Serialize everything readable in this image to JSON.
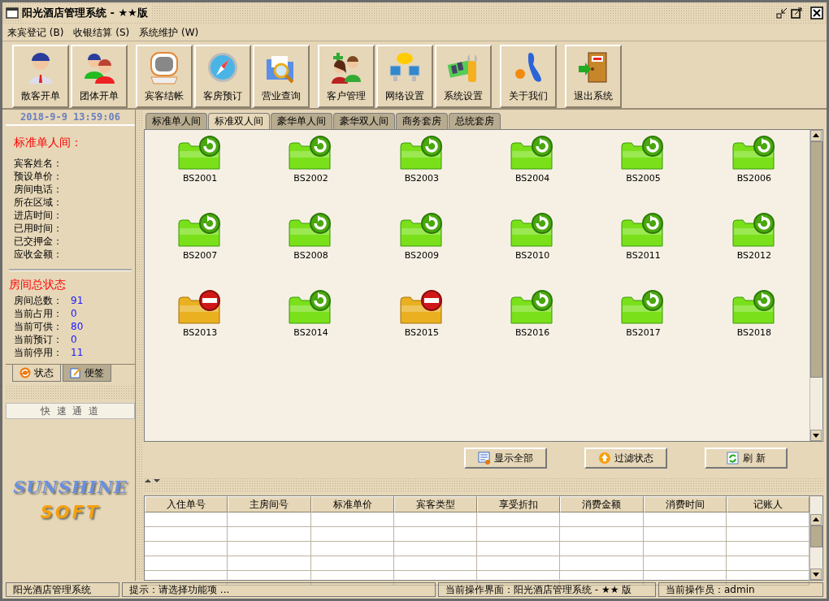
{
  "window": {
    "title": "阳光酒店管理系统 - ★★版"
  },
  "menu": [
    {
      "label": "来宾登记 (B)"
    },
    {
      "label": "收银结算 (S)"
    },
    {
      "label": "系统维护 (W)"
    }
  ],
  "toolbar": [
    {
      "buttons": [
        "散客开单",
        "团体开单"
      ]
    },
    {
      "buttons": [
        "宾客结帐",
        "客房预订",
        "营业查询"
      ]
    },
    {
      "buttons": [
        "客户管理",
        "网络设置",
        "系统设置"
      ]
    },
    {
      "buttons": [
        "关于我们"
      ]
    },
    {
      "buttons": [
        "退出系统"
      ]
    }
  ],
  "clock": "2018-9-9  13:59:06",
  "room_info": {
    "title": "标准单人间：",
    "fields": [
      "宾客姓名：",
      "预设单价：",
      "房间电话：",
      "所在区域：",
      "进店时间：",
      "已用时间：",
      "已交押金：",
      "应收金额："
    ]
  },
  "room_status": {
    "title": "房间总状态",
    "rows": [
      {
        "label": "房间总数：",
        "value": "91"
      },
      {
        "label": "当前占用：",
        "value": "0"
      },
      {
        "label": "当前可供：",
        "value": "80"
      },
      {
        "label": "当前预订：",
        "value": "0"
      },
      {
        "label": "当前停用：",
        "value": "11"
      }
    ]
  },
  "side_tabs": [
    {
      "label": "状态",
      "selected": true
    },
    {
      "label": "便签",
      "selected": false
    }
  ],
  "quick_access": {
    "title": "快 速 通 道",
    "logo": [
      "SUNSHINE",
      "SOFT"
    ]
  },
  "room_tabs": [
    {
      "label": "标准单人间",
      "selected": false
    },
    {
      "label": "标准双人间",
      "selected": true
    },
    {
      "label": "豪华单人间",
      "selected": false
    },
    {
      "label": "豪华双人间",
      "selected": false
    },
    {
      "label": "商务套房",
      "selected": false
    },
    {
      "label": "总统套房",
      "selected": false
    }
  ],
  "rooms": [
    {
      "number": "BS2001",
      "disabled": false
    },
    {
      "number": "BS2002",
      "disabled": false
    },
    {
      "number": "BS2003",
      "disabled": false
    },
    {
      "number": "BS2004",
      "disabled": false
    },
    {
      "number": "BS2005",
      "disabled": false
    },
    {
      "number": "BS2006",
      "disabled": false
    },
    {
      "number": "BS2007",
      "disabled": false
    },
    {
      "number": "BS2008",
      "disabled": false
    },
    {
      "number": "BS2009",
      "disabled": false
    },
    {
      "number": "BS2010",
      "disabled": false
    },
    {
      "number": "BS2011",
      "disabled": false
    },
    {
      "number": "BS2012",
      "disabled": false
    },
    {
      "number": "BS2013",
      "disabled": true
    },
    {
      "number": "BS2014",
      "disabled": false
    },
    {
      "number": "BS2015",
      "disabled": true
    },
    {
      "number": "BS2016",
      "disabled": false
    },
    {
      "number": "BS2017",
      "disabled": false
    },
    {
      "number": "BS2018",
      "disabled": false
    }
  ],
  "actions": [
    "显示全部",
    "过滤状态",
    "刷 新"
  ],
  "table": {
    "columns": [
      "入住单号",
      "主房间号",
      "标准单价",
      "宾客类型",
      "享受折扣",
      "消费金额",
      "消费时间",
      "记账人"
    ]
  },
  "status_bar": [
    "阳光酒店管理系统",
    "提示：请选择功能项 ...",
    "当前操作界面：阳光酒店管理系统 - ★★ 版",
    "当前操作员：admin"
  ]
}
